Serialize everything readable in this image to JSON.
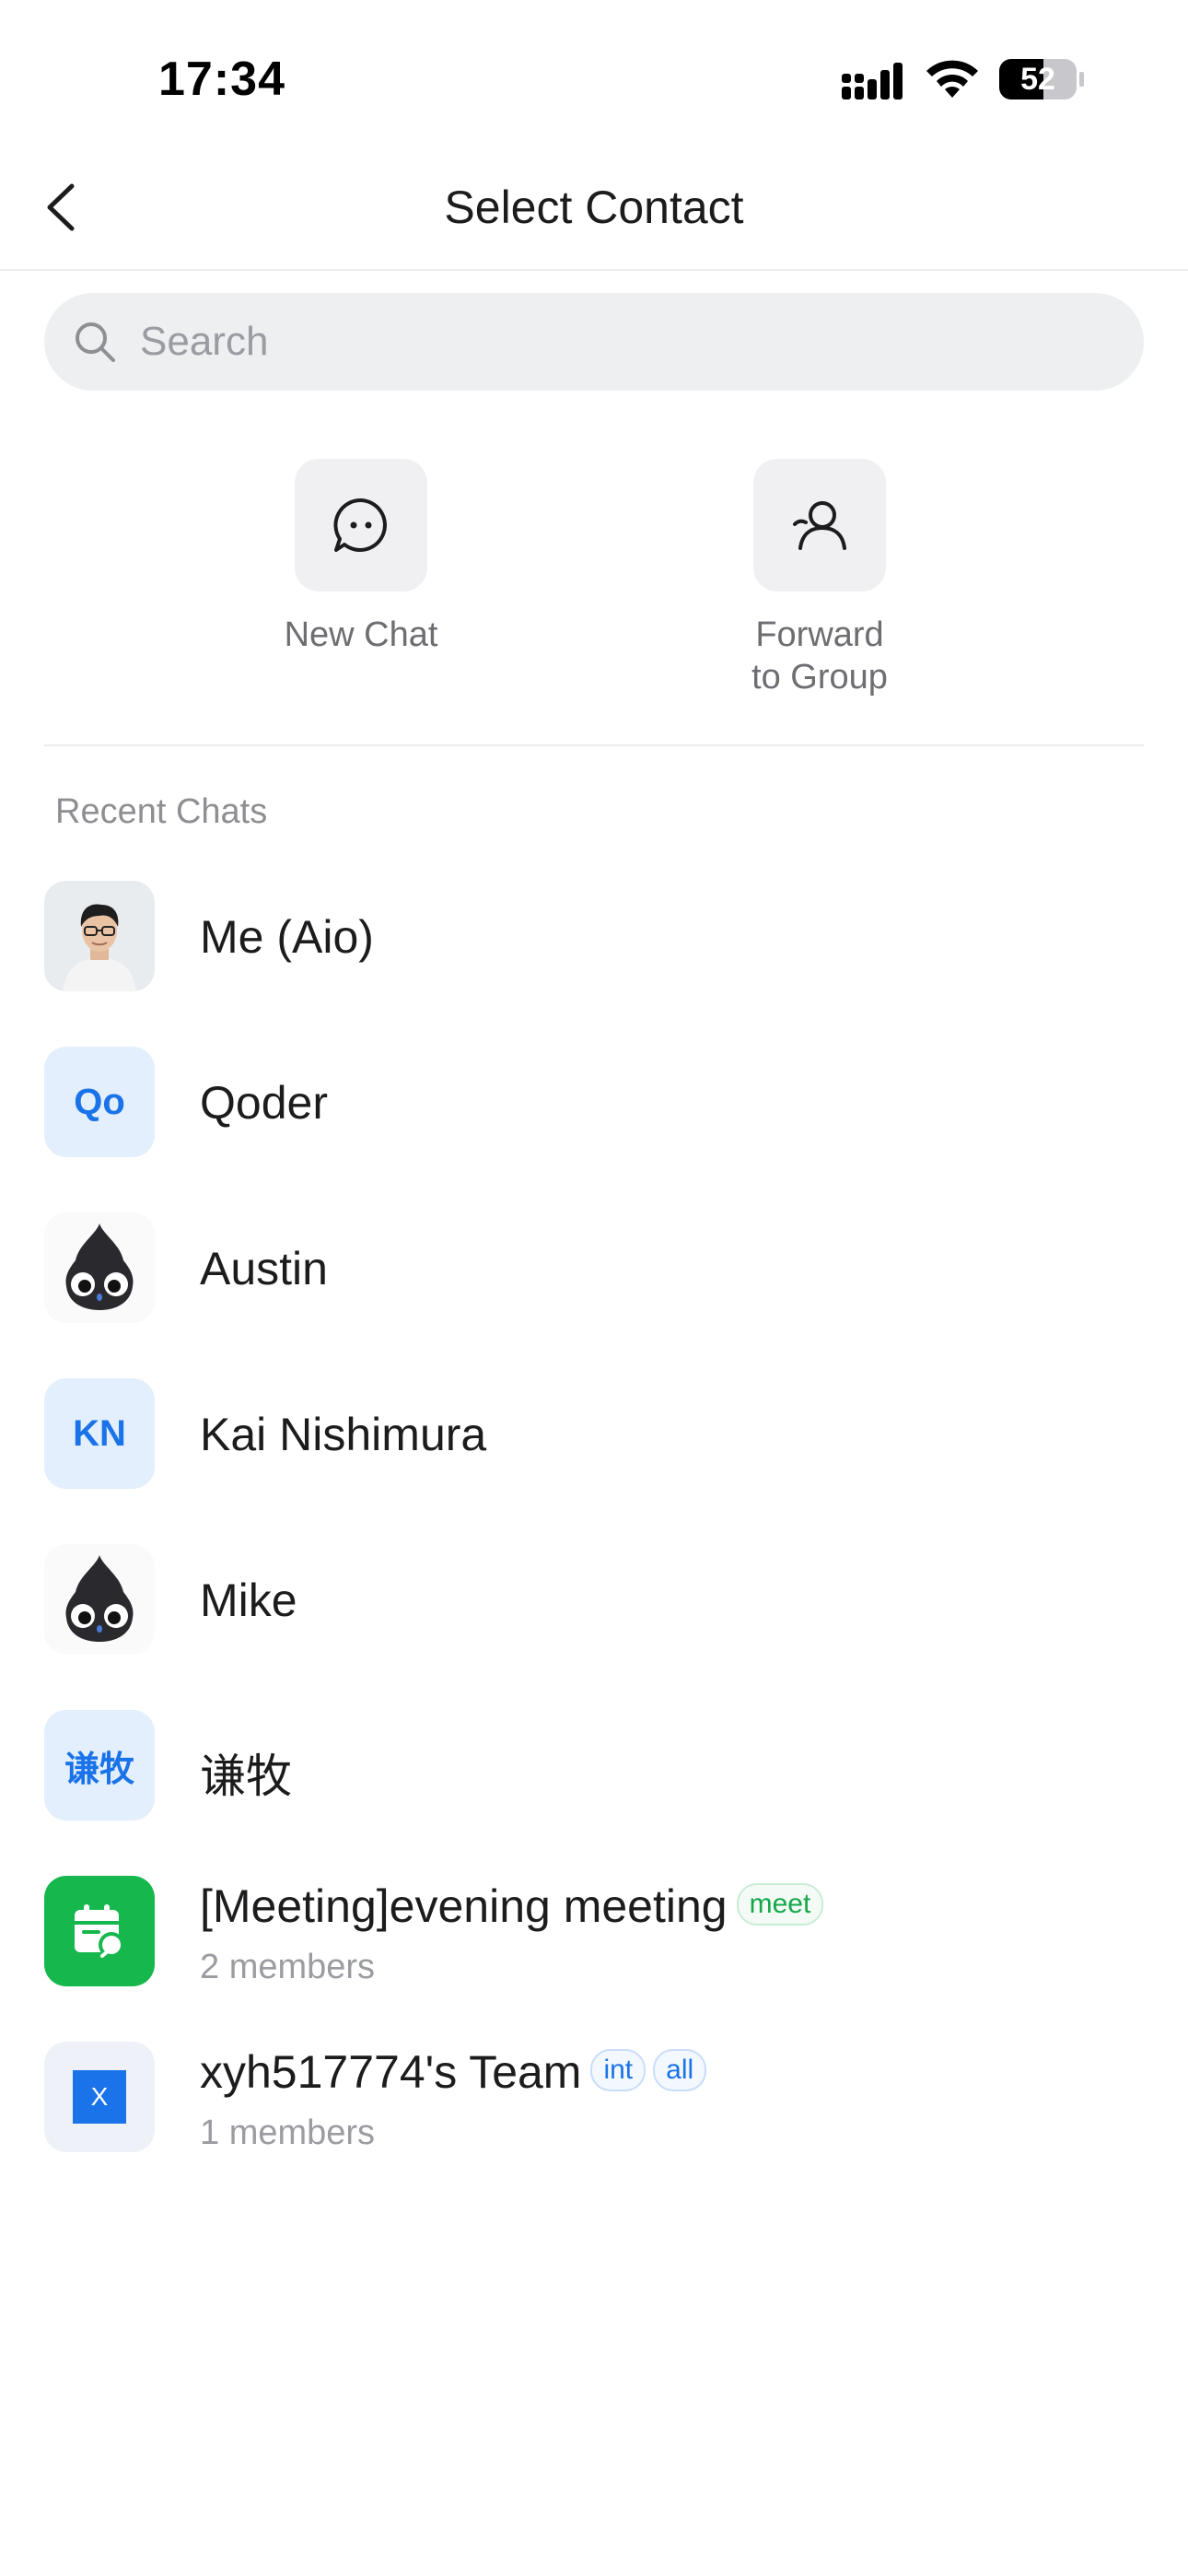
{
  "status_bar": {
    "time": "17:34",
    "battery_level": "52",
    "icons": [
      "signal-icon",
      "wifi-icon",
      "battery-icon"
    ]
  },
  "nav": {
    "title": "Select Contact",
    "back_icon": "chevron-left-icon"
  },
  "search": {
    "placeholder": "Search",
    "icon": "search-icon"
  },
  "quick_actions": [
    {
      "label": "New Chat",
      "icon": "chat-bubble-icon"
    },
    {
      "label_line1": "Forward",
      "label_line2": "to Group",
      "icon": "person-icon"
    }
  ],
  "section": {
    "label": "Recent Chats"
  },
  "contacts": [
    {
      "name": "Me (Aio)",
      "avatar": "photo-avatar"
    },
    {
      "name": "Qoder",
      "avatar_text": "Qo"
    },
    {
      "name": "Austin",
      "avatar": "cartoon-avatar"
    },
    {
      "name": "Kai Nishimura",
      "avatar_text": "KN"
    },
    {
      "name": "Mike",
      "avatar": "cartoon-avatar"
    },
    {
      "name": "谦牧",
      "avatar_text": "谦牧"
    },
    {
      "name": "[Meeting]evening meeting",
      "tag": "meet",
      "members": "2 members",
      "avatar": "meeting-calendar-icon"
    },
    {
      "name": "xyh517774's Team",
      "tags": [
        "int",
        "all"
      ],
      "members": "1 members",
      "avatar_text": "X"
    }
  ],
  "colors": {
    "accent_blue": "#1a73e8",
    "meeting_green": "#16b84e",
    "avatar_light_blue": "#e4effd",
    "search_bg": "#eeeff1"
  }
}
